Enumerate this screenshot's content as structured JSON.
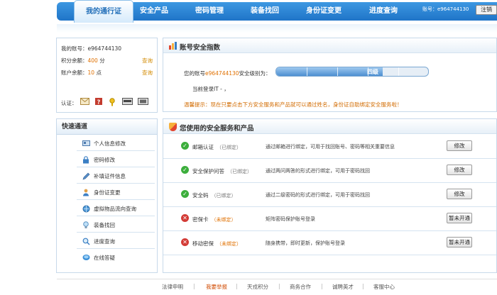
{
  "nav": {
    "tabs": [
      {
        "label": "我的通行证"
      },
      {
        "label": "安全产品"
      },
      {
        "label": "密码管理"
      },
      {
        "label": "装备找回"
      },
      {
        "label": "身份证变更"
      },
      {
        "label": "进度查询"
      }
    ],
    "account_label": "账号：e964744130",
    "logout_label": "注销"
  },
  "account": {
    "account_label": "我的账号：",
    "account_value": "e964744130",
    "points_label": "积分余额：",
    "points_value": "400",
    "points_unit": "分",
    "balance_label": "账户余额：",
    "balance_value": "10",
    "balance_unit": "点",
    "query_label": "查询",
    "auth_label": "认证："
  },
  "quick": {
    "title": "快速通道",
    "items": [
      {
        "label": "个人信息修改",
        "icon": "id-card-icon"
      },
      {
        "label": "密码修改",
        "icon": "lock-icon"
      },
      {
        "label": "补填证件信息",
        "icon": "pen-icon"
      },
      {
        "label": "身份证变更",
        "icon": "person-icon"
      },
      {
        "label": "虚拟物品流向查询",
        "icon": "globe-icon"
      },
      {
        "label": "装备找回",
        "icon": "bulb-icon"
      },
      {
        "label": "进度查询",
        "icon": "search-icon"
      },
      {
        "label": "在线答疑",
        "icon": "chat-icon"
      }
    ]
  },
  "index": {
    "title": "账号安全指数",
    "level_prefix": "您的账号",
    "level_account": "e964744130",
    "level_suffix": "安全级别为：",
    "level_text": "四级",
    "level_fraction": 0.7,
    "last_login": "当前登录IT - ，",
    "tip": "温馨提示：现在只要点击下方安全服务和产品就可以通过姓名，身份证自助绑定安全服务啦！"
  },
  "services": {
    "title": "您使用的安全服务和产品",
    "rows": [
      {
        "name": "邮箱认证",
        "state": "（已绑定）",
        "bound": true,
        "desc": "通过邮箱进行绑定，可用于找回账号、密码等相关重要信息",
        "button": "修改"
      },
      {
        "name": "安全保护问答",
        "state": "（已绑定）",
        "bound": true,
        "desc": "通过两问两答的形式进行绑定，可用于密码找回",
        "button": "修改"
      },
      {
        "name": "安全码",
        "state": "（已绑定）",
        "bound": true,
        "desc": "通过二级密码的形式进行绑定，可用于密码找回",
        "button": "修改"
      },
      {
        "name": "密保卡",
        "state": "（未绑定）",
        "bound": false,
        "desc": "矩阵密码保护账号登录",
        "button": "暂未开通"
      },
      {
        "name": "移动密保",
        "state": "（未绑定）",
        "bound": false,
        "desc": "随身携带，即时更新，保护账号登录",
        "button": "暂未开通"
      }
    ]
  },
  "footer": {
    "links": [
      "法律申明",
      "我要举报",
      "天戎积分",
      "商务合作",
      "诚聘英才",
      "客服中心"
    ]
  },
  "colors": {
    "nav_blue": "#1f74c8",
    "accent_orange": "#e07000",
    "ok_green": "#3cae3c",
    "error_red": "#d33b36"
  }
}
